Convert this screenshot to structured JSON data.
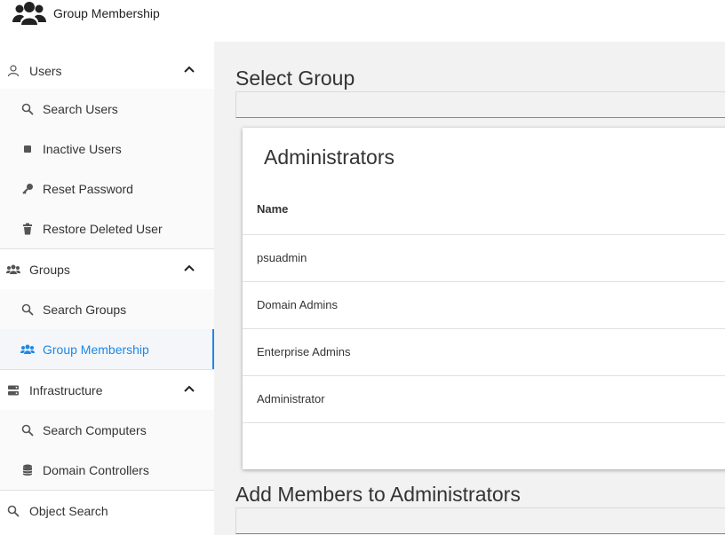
{
  "app": {
    "title": "Group Membership",
    "icon": "group-icon"
  },
  "sidebar": {
    "sections": [
      {
        "label": "Users",
        "icon": "person-icon",
        "expanded": true,
        "children": [
          {
            "label": "Search Users",
            "icon": "search-icon"
          },
          {
            "label": "Inactive Users",
            "icon": "stop-icon"
          },
          {
            "label": "Reset Password",
            "icon": "key-icon"
          },
          {
            "label": "Restore Deleted User",
            "icon": "trash-icon"
          }
        ]
      },
      {
        "label": "Groups",
        "icon": "group-icon",
        "expanded": true,
        "children": [
          {
            "label": "Search Groups",
            "icon": "search-icon"
          },
          {
            "label": "Group Membership",
            "icon": "group-icon",
            "active": true
          }
        ]
      },
      {
        "label": "Infrastructure",
        "icon": "server-icon",
        "expanded": true,
        "children": [
          {
            "label": "Search Computers",
            "icon": "search-icon"
          },
          {
            "label": "Domain Controllers",
            "icon": "database-icon"
          }
        ]
      }
    ],
    "object_search": {
      "label": "Object Search",
      "icon": "search-icon"
    }
  },
  "main": {
    "select_heading": "Select Group",
    "card": {
      "title": "Administrators",
      "column": "Name",
      "rows": [
        "psuadmin",
        "Domain Admins",
        "Enterprise Admins",
        "Administrator"
      ]
    },
    "add_heading": "Add Members to Administrators"
  },
  "colors": {
    "accent": "#1e88e5",
    "background": "#f2f2f2"
  }
}
